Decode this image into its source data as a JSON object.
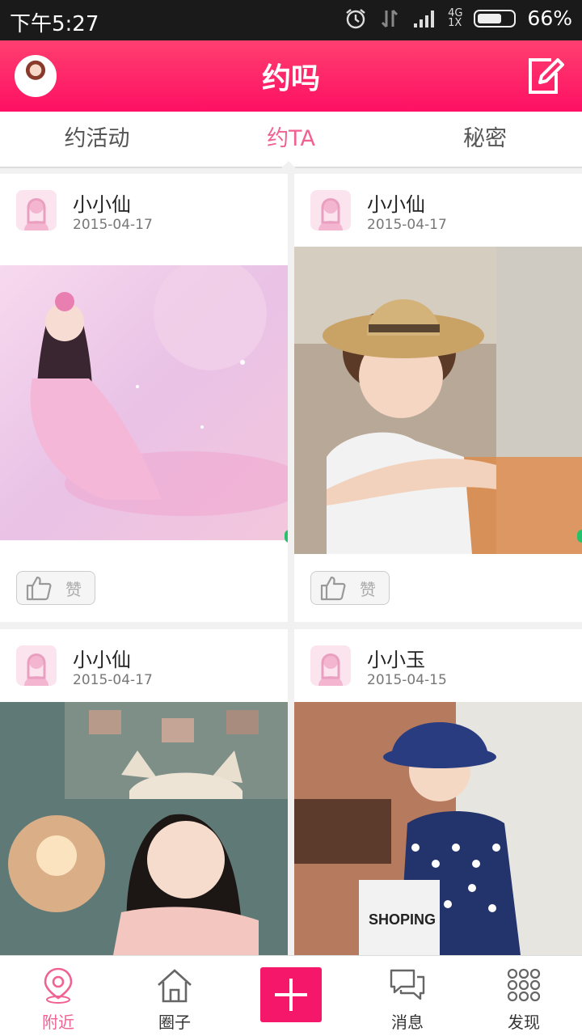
{
  "status_bar": {
    "time": "下午5:27",
    "network_top": "4G",
    "network_bottom": "1X",
    "battery": "66%",
    "icons": [
      "alarm-icon",
      "data-arrows-icon",
      "signal-icon",
      "battery-icon"
    ]
  },
  "header": {
    "title": "约吗",
    "avatar_icon": "user-avatar",
    "edit_icon": "edit-icon"
  },
  "tabs": [
    {
      "label": "约活动",
      "active": false
    },
    {
      "label": "约TA",
      "active": true
    },
    {
      "label": "秘密",
      "active": false
    }
  ],
  "posts": [
    {
      "name": "小小仙",
      "date": "2015-04-17",
      "like_label": "赞"
    },
    {
      "name": "小小仙",
      "date": "2015-04-17",
      "like_label": "赞"
    },
    {
      "name": "小小仙",
      "date": "2015-04-17"
    },
    {
      "name": "小小玉",
      "date": "2015-04-15"
    }
  ],
  "bottom_nav": [
    {
      "label": "附近",
      "icon": "location-pin-icon",
      "active": true
    },
    {
      "label": "圈子",
      "icon": "home-icon",
      "active": false
    },
    {
      "label": "",
      "icon": "plus-icon",
      "active": false
    },
    {
      "label": "消息",
      "icon": "chat-bubbles-icon",
      "active": false
    },
    {
      "label": "发现",
      "icon": "grid-dots-icon",
      "active": false
    }
  ],
  "colors": {
    "accent": "#fd1063",
    "active_tab": "#f06292",
    "background": "#f1f1f1"
  }
}
